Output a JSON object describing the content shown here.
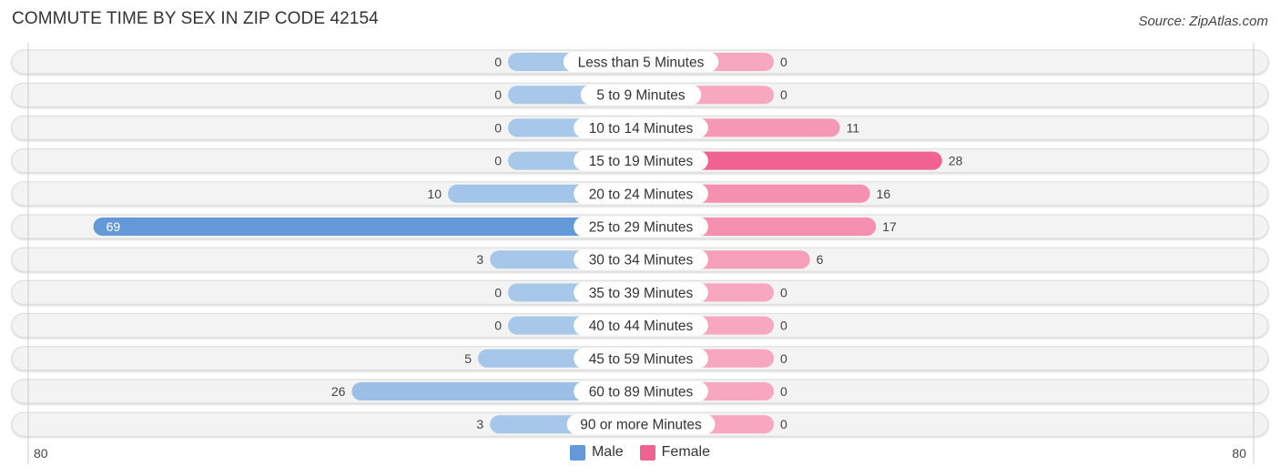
{
  "header": {
    "title": "COMMUTE TIME BY SEX IN ZIP CODE 42154",
    "source": "Source: ZipAtlas.com"
  },
  "colors": {
    "male_light": "#a8c8ea",
    "male_dark": "#6399d8",
    "female_light": "#f7a8c0",
    "female_dark": "#f06292",
    "row_bg": "#f3f3f3"
  },
  "chart_data": {
    "type": "bar",
    "orientation": "diverging-horizontal",
    "title": "COMMUTE TIME BY SEX IN ZIP CODE 42154",
    "categories": [
      "Less than 5 Minutes",
      "5 to 9 Minutes",
      "10 to 14 Minutes",
      "15 to 19 Minutes",
      "20 to 24 Minutes",
      "25 to 29 Minutes",
      "30 to 34 Minutes",
      "35 to 39 Minutes",
      "40 to 44 Minutes",
      "45 to 59 Minutes",
      "60 to 89 Minutes",
      "90 or more Minutes"
    ],
    "series": [
      {
        "name": "Male",
        "values": [
          0,
          0,
          0,
          0,
          10,
          69,
          3,
          0,
          0,
          5,
          26,
          3
        ]
      },
      {
        "name": "Female",
        "values": [
          0,
          0,
          11,
          28,
          16,
          17,
          6,
          0,
          0,
          0,
          0,
          0
        ]
      }
    ],
    "axis": {
      "left_max_label": "80",
      "right_max_label": "80",
      "max": 80
    },
    "legend": {
      "position": "bottom-center",
      "entries": [
        "Male",
        "Female"
      ]
    }
  }
}
